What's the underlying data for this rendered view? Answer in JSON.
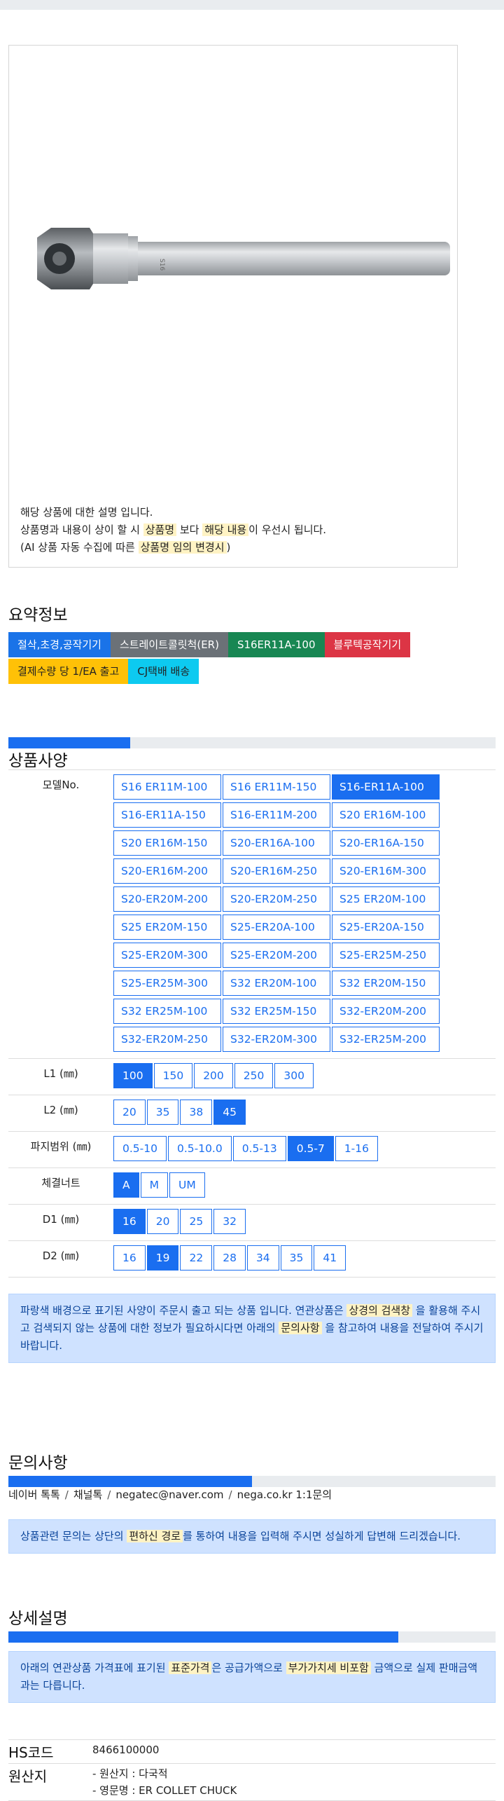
{
  "image_desc": {
    "line1": "해당 상품에 대한 설명 입니다.",
    "line2_a": "상품명과 내용이 상이 할 시 ",
    "line2_b": "상품명",
    "line2_c": " 보다 ",
    "line2_d": "해당 내용",
    "line2_e": "이 우선시 됩니다.",
    "line3_a": "(AI 상품 자동 수집에 따른 ",
    "line3_b": "상품명 임의 변경시",
    "line3_c": ")"
  },
  "summary": {
    "title": "요약정보",
    "tags_row1": [
      "절삭,초경,공작기기",
      "스트레이트콜릿척(ER)",
      "S16ER11A-100",
      "블루텍공작기기"
    ],
    "tags_row2": [
      "결제수량 당 1/EA 출고",
      "CJ택배 배송"
    ]
  },
  "spec": {
    "title": "상품사양",
    "progress": 0.25,
    "model_label": "모델No.",
    "models": [
      "S16 ER11M-100",
      "S16 ER11M-150",
      "S16-ER11A-100",
      "S16-ER11A-150",
      "S16-ER11M-200",
      "S20 ER16M-100",
      "S20 ER16M-150",
      "S20-ER16A-100",
      "S20-ER16A-150",
      "S20-ER16M-200",
      "S20-ER16M-250",
      "S20-ER16M-300",
      "S20-ER20M-200",
      "S20-ER20M-250",
      "S25 ER20M-100",
      "S25 ER20M-150",
      "S25-ER20A-100",
      "S25-ER20A-150",
      "S25-ER20M-300",
      "S25-ER20M-200",
      "S25-ER25M-250",
      "S25-ER25M-300",
      "S32 ER20M-100",
      "S32 ER20M-150",
      "S32 ER25M-100",
      "S32 ER25M-150",
      "S32-ER20M-200",
      "S32-ER20M-250",
      "S32-ER20M-300",
      "S32-ER25M-200"
    ],
    "model_selected": 2,
    "rows": [
      {
        "label": "L1 (㎜)",
        "options": [
          "100",
          "150",
          "200",
          "250",
          "300"
        ],
        "selected": 0
      },
      {
        "label": "L2 (㎜)",
        "options": [
          "20",
          "35",
          "38",
          "45"
        ],
        "selected": 3
      },
      {
        "label": "파지범위 (㎜)",
        "options": [
          "0.5-10",
          "0.5-10.0",
          "0.5-13",
          "0.5-7",
          "1-16"
        ],
        "selected": 3
      },
      {
        "label": "체결너트",
        "options": [
          "A",
          "M",
          "UM"
        ],
        "selected": 0
      },
      {
        "label": "D1 (㎜)",
        "options": [
          "16",
          "20",
          "25",
          "32"
        ],
        "selected": 0
      },
      {
        "label": "D2 (㎜)",
        "options": [
          "16",
          "19",
          "22",
          "28",
          "34",
          "35",
          "41"
        ],
        "selected": 1
      }
    ],
    "note_a": "파랑색 배경으로 표기된 사양이 주문시 출고 되는 상품 입니다. 연관상품은 ",
    "note_b": "상경의 검색창",
    "note_c": " 을 활용해 주시고 검색되지 않는 상품에 대한 정보가 필요하시다면 아래의 ",
    "note_d": "문의사항",
    "note_e": " 을 참고하여 내용을 전달하여 주시기 바랍니다."
  },
  "inquiry": {
    "title": "문의사항",
    "progress": 0.5,
    "links": [
      "네이버 톡톡",
      "채널톡",
      "negatec@naver.com",
      "nega.co.kr 1:1문의"
    ],
    "note_a": "상품관련 문의는 상단의 ",
    "note_b": "편하신 경로",
    "note_c": "를 통하여 내용을 입력해 주시면 성실하게 답변해 드리겠습니다."
  },
  "detail": {
    "title": "상세설명",
    "progress": 0.8,
    "note_a": "아래의 연관상품 가격표에 표기된 ",
    "note_b": "표준가격",
    "note_c": "은 공급가액으로 ",
    "note_d": "부가가치세 비포함",
    "note_e": " 금액으로 실제 판매금액과는 다릅니다."
  },
  "info": {
    "hs_label": "HS코드",
    "hs_value": "8466100000",
    "origin_label": "원산지",
    "origin_line1": "- 원산지 : 다국적",
    "origin_line2": "- 영문명 : ER COLLET CHUCK"
  }
}
